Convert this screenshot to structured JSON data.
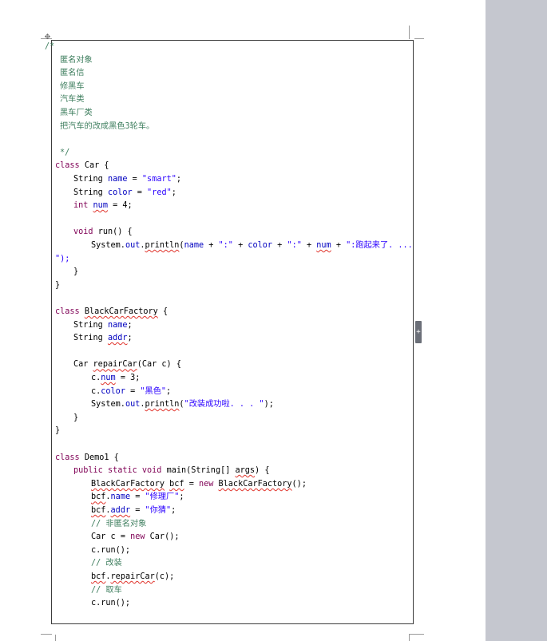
{
  "colors": {
    "comment": "#3f7f5f",
    "keyword": "#7f0055",
    "string": "#2a00ff",
    "field": "#0000c0",
    "spellcheck": "#e0332b",
    "scroll_area": "#c5c7cf"
  },
  "icons": {
    "move_handle": "move-icon",
    "add_column": "plus-icon"
  },
  "code": {
    "comment_open": "/*",
    "c1": "匿名对象",
    "c2": "匿名信",
    "c3": "修黑车",
    "c4": "汽车类",
    "c5": "黑车厂类",
    "c6": "把汽车的改成黑色3轮车。",
    "comment_close": "*/",
    "kw_class": "class",
    "kw_int": "int",
    "kw_void": "void",
    "kw_public": "public",
    "kw_static": "static",
    "kw_new": "new",
    "t_string": "String",
    "car_class": "Car",
    "bcf_class": "BlackCarFactory",
    "demo_class": "Demo1",
    "open_brace": "{",
    "close_brace": "}",
    "f_name": "name",
    "f_color": "color",
    "f_num": "num",
    "f_addr": "addr",
    "f_out": "out",
    "eq": "=",
    "semi": ";",
    "s_smart": "\"smart\"",
    "s_red": "\"red\"",
    "n_4": "4",
    "n_3": "3",
    "m_run": "run",
    "m_println": "println",
    "m_repair": "repairCar",
    "m_main": "main",
    "paren_empty": "()",
    "system": "System.",
    "dot": ".",
    "plus": "+",
    "s_colon": "\":\"",
    "s_run_msg": "\":跑起来了. ...",
    "s_run_msg_end": "\");",
    "p_car_c": "(Car c)",
    "c_dot": "c.",
    "s_black": "\"黑色\"",
    "s_done": "\"改装成功啦. . . \"",
    "p_args_type": "(String[]",
    "p_args": "args",
    "p_args_close": ")",
    "v_bcf": "bcf",
    "s_repair_shop": "\"修理厂\"",
    "s_guess": "\"你猜\"",
    "cm_non_anon": "// 非匿名对象",
    "v_c": "c",
    "cm_modify": "// 改装",
    "cm_get_car": "// 取车",
    "c_run_call": "c.run();",
    "call_repair_arg": "(c);",
    "call_open": "(",
    "call_close": ");"
  }
}
